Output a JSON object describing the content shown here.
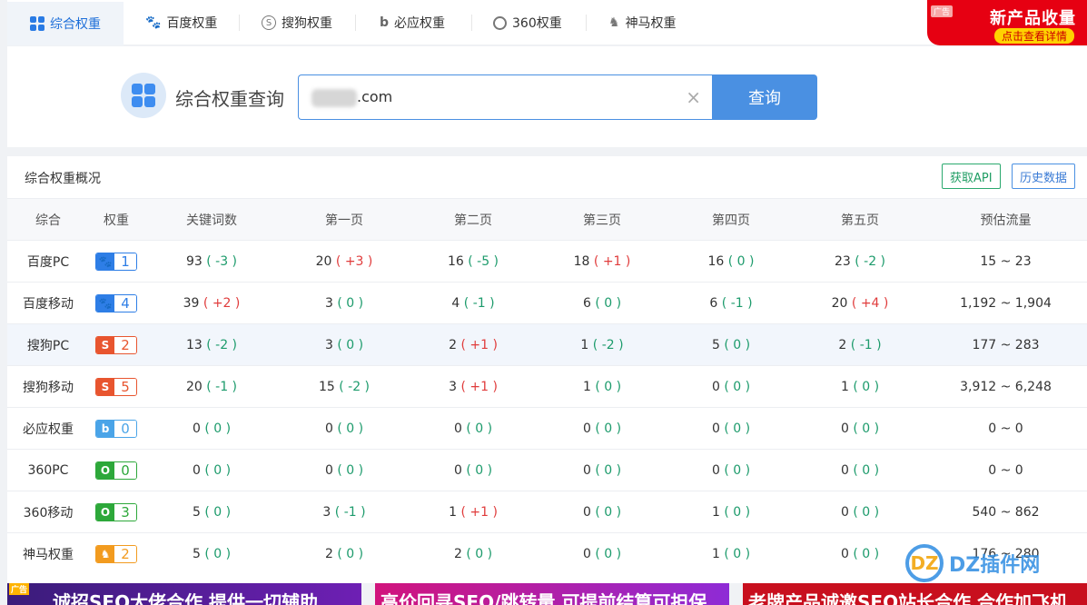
{
  "tabs": [
    {
      "label": "综合权重",
      "icon": "grid-icon",
      "active": true
    },
    {
      "label": "百度权重",
      "icon": "baidu-paw-icon"
    },
    {
      "label": "搜狗权重",
      "icon": "sogou-icon"
    },
    {
      "label": "必应权重",
      "icon": "bing-icon"
    },
    {
      "label": "360权重",
      "icon": "360-icon"
    },
    {
      "label": "神马权重",
      "icon": "shenma-icon"
    }
  ],
  "ad_corner": {
    "tag": "广告",
    "title": "新产品收量",
    "link": "点击查看详情"
  },
  "search": {
    "title": "综合权重查询",
    "value": ".com",
    "clear": "×",
    "button": "查询"
  },
  "overview": {
    "title": "综合权重概况",
    "api_button": "获取API",
    "history_button": "历史数据",
    "headers": [
      "综合",
      "权重",
      "关键词数",
      "第一页",
      "第二页",
      "第三页",
      "第四页",
      "第五页",
      "预估流量"
    ],
    "rows": [
      {
        "name": "百度PC",
        "engine": "baidu",
        "icon": "baidu-paw-icon",
        "weight": "1",
        "cells": [
          [
            "93",
            "( -3 )",
            "neg"
          ],
          [
            "20",
            "( +3 )",
            "pos"
          ],
          [
            "16",
            "( -5 )",
            "neg"
          ],
          [
            "18",
            "( +1 )",
            "pos"
          ],
          [
            "16",
            "( 0 )",
            "zero"
          ],
          [
            "23",
            "( -2 )",
            "neg"
          ]
        ],
        "traffic": "15 ~ 23"
      },
      {
        "name": "百度移动",
        "engine": "baidu",
        "icon": "baidu-paw-icon",
        "weight": "4",
        "cells": [
          [
            "39",
            "( +2 )",
            "pos"
          ],
          [
            "3",
            "( 0 )",
            "zero"
          ],
          [
            "4",
            "( -1 )",
            "neg"
          ],
          [
            "6",
            "( 0 )",
            "zero"
          ],
          [
            "6",
            "( -1 )",
            "neg"
          ],
          [
            "20",
            "( +4 )",
            "pos"
          ]
        ],
        "traffic": "1,192 ~ 1,904"
      },
      {
        "name": "搜狗PC",
        "engine": "sogou",
        "icon": "sogou-icon",
        "weight": "2",
        "cells": [
          [
            "13",
            "( -2 )",
            "neg"
          ],
          [
            "3",
            "( 0 )",
            "zero"
          ],
          [
            "2",
            "( +1 )",
            "pos"
          ],
          [
            "1",
            "( -2 )",
            "neg"
          ],
          [
            "5",
            "( 0 )",
            "zero"
          ],
          [
            "2",
            "( -1 )",
            "neg"
          ]
        ],
        "traffic": "177 ~ 283"
      },
      {
        "name": "搜狗移动",
        "engine": "sogou",
        "icon": "sogou-icon",
        "weight": "5",
        "cells": [
          [
            "20",
            "( -1 )",
            "neg"
          ],
          [
            "15",
            "( -2 )",
            "neg"
          ],
          [
            "3",
            "( +1 )",
            "pos"
          ],
          [
            "1",
            "( 0 )",
            "zero"
          ],
          [
            "0",
            "( 0 )",
            "zero"
          ],
          [
            "1",
            "( 0 )",
            "zero"
          ]
        ],
        "traffic": "3,912 ~ 6,248"
      },
      {
        "name": "必应权重",
        "engine": "bing",
        "icon": "bing-icon",
        "weight": "0",
        "cells": [
          [
            "0",
            "( 0 )",
            "zero"
          ],
          [
            "0",
            "( 0 )",
            "zero"
          ],
          [
            "0",
            "( 0 )",
            "zero"
          ],
          [
            "0",
            "( 0 )",
            "zero"
          ],
          [
            "0",
            "( 0 )",
            "zero"
          ],
          [
            "0",
            "( 0 )",
            "zero"
          ]
        ],
        "traffic": "0 ~ 0"
      },
      {
        "name": "360PC",
        "engine": "360",
        "icon": "360-icon",
        "weight": "0",
        "cells": [
          [
            "0",
            "( 0 )",
            "zero"
          ],
          [
            "0",
            "( 0 )",
            "zero"
          ],
          [
            "0",
            "( 0 )",
            "zero"
          ],
          [
            "0",
            "( 0 )",
            "zero"
          ],
          [
            "0",
            "( 0 )",
            "zero"
          ],
          [
            "0",
            "( 0 )",
            "zero"
          ]
        ],
        "traffic": "0 ~ 0"
      },
      {
        "name": "360移动",
        "engine": "360",
        "icon": "360-icon",
        "weight": "3",
        "cells": [
          [
            "5",
            "( 0 )",
            "zero"
          ],
          [
            "3",
            "( -1 )",
            "neg"
          ],
          [
            "1",
            "( +1 )",
            "pos"
          ],
          [
            "0",
            "( 0 )",
            "zero"
          ],
          [
            "1",
            "( 0 )",
            "zero"
          ],
          [
            "0",
            "( 0 )",
            "zero"
          ]
        ],
        "traffic": "540 ~ 862"
      },
      {
        "name": "神马权重",
        "engine": "sm",
        "icon": "shenma-icon",
        "weight": "2",
        "cells": [
          [
            "5",
            "( 0 )",
            "zero"
          ],
          [
            "2",
            "( 0 )",
            "zero"
          ],
          [
            "2",
            "( 0 )",
            "zero"
          ],
          [
            "0",
            "( 0 )",
            "zero"
          ],
          [
            "1",
            "( 0 )",
            "zero"
          ],
          [
            "0",
            "( 0 )",
            "zero"
          ]
        ],
        "traffic": "176 ~ 280"
      }
    ]
  },
  "bottom_ads": [
    {
      "tag": "广告",
      "text": "诚招SEO大佬合作 提供一切辅助"
    },
    {
      "tag": "",
      "text": "高价回寻SEO/跳转量 可提前结算可担保"
    },
    {
      "tag": "",
      "text": "老牌产品诚邀SEO站长合作 合作加飞机"
    }
  ],
  "watermark": {
    "logo": "DZ",
    "text": "DZ插件网"
  },
  "colors": {
    "accent": "#4a90e2",
    "positive": "#e03c3c",
    "negative": "#1d9b6c"
  }
}
